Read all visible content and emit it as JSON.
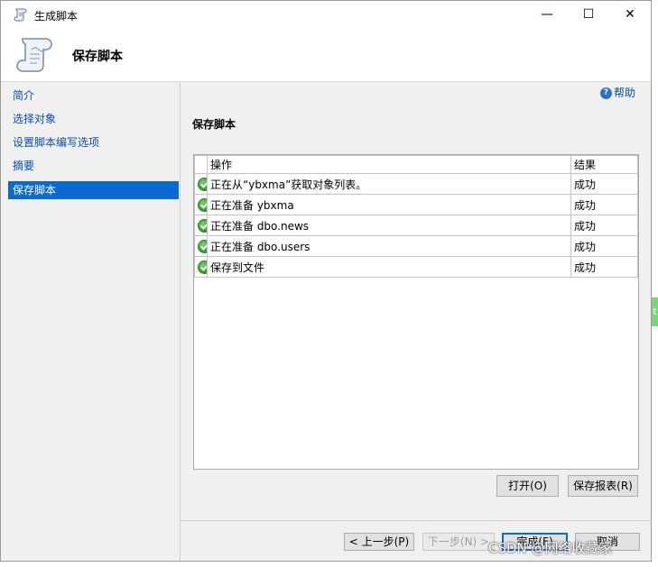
{
  "window": {
    "title": "生成脚本",
    "minimize": "—",
    "maximize": "☐",
    "close": "✕"
  },
  "header": {
    "title": "保存脚本",
    "icon": "script-scroll-icon"
  },
  "nav": {
    "items": [
      {
        "label": "简介",
        "active": false
      },
      {
        "label": "选择对象",
        "active": false
      },
      {
        "label": "设置脚本编写选项",
        "active": false
      },
      {
        "label": "摘要",
        "active": false
      },
      {
        "label": "保存脚本",
        "active": true
      }
    ]
  },
  "help": {
    "label": "帮助",
    "icon": "help-icon"
  },
  "section": {
    "title": "保存脚本"
  },
  "table": {
    "columns": [
      "操作",
      "结果"
    ],
    "rows": [
      {
        "status_icon": "success-check-icon",
        "action": "正在从“ybxma”获取对象列表。",
        "result": "成功"
      },
      {
        "status_icon": "success-check-icon",
        "action": "正在准备 ybxma",
        "result": "成功"
      },
      {
        "status_icon": "success-check-icon",
        "action": "正在准备 dbo.news",
        "result": "成功"
      },
      {
        "status_icon": "success-check-icon",
        "action": "正在准备 dbo.users",
        "result": "成功"
      },
      {
        "status_icon": "success-check-icon",
        "action": "保存到文件",
        "result": "成功"
      }
    ]
  },
  "actions": {
    "open": "打开(O)",
    "save_report": "保存报表(R)"
  },
  "footer": {
    "prev": "< 上一步(P)",
    "next": "下一步(N) >",
    "finish": "完成(F)",
    "cancel": "取消"
  },
  "side_tab": "t",
  "watermark": "CSDN @网络收藏家",
  "colors": {
    "selection": "#0a6ad1",
    "link": "#0b4db3",
    "success": "#2e9a2a"
  }
}
